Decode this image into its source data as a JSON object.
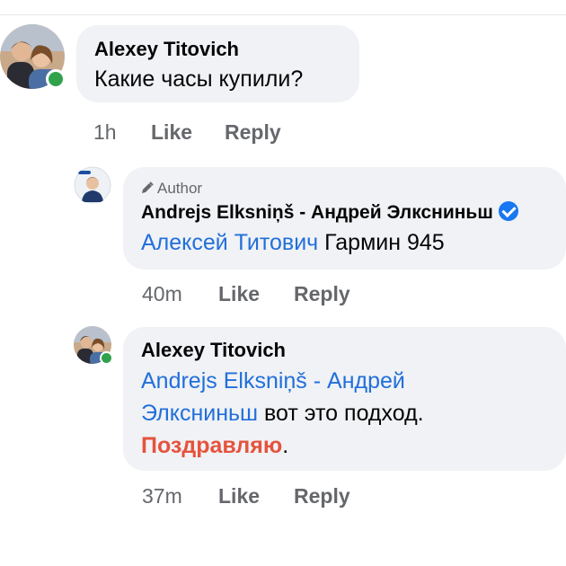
{
  "comments": [
    {
      "author": "Alexey Titovich",
      "text": "Какие часы купили?",
      "time": "1h",
      "like": "Like",
      "reply": "Reply"
    },
    {
      "badge": "Author",
      "author": "Andrejs Elksniņš - Андрей Элксниньш",
      "verified": true,
      "mention": "Алексей Титович",
      "text": " Гармин 945",
      "time": "40m",
      "like": "Like",
      "reply": "Reply"
    },
    {
      "author": "Alexey Titovich",
      "mention_line1": "Andrejs Elksniņš - Андрей",
      "mention_line2": "Элксниньш",
      "text_after_mention": " вот это подход.",
      "highlight": "Поздравляю",
      "trailing": ".",
      "time": "37m",
      "like": "Like",
      "reply": "Reply"
    }
  ],
  "colors": {
    "bubble_bg": "#f0f2f5",
    "mention": "#216fdb",
    "highlight": "#e5533d",
    "online": "#31a24c",
    "verified": "#1877f2"
  },
  "icons": [
    "pencil-icon",
    "verified-badge-icon",
    "online-status-icon"
  ]
}
